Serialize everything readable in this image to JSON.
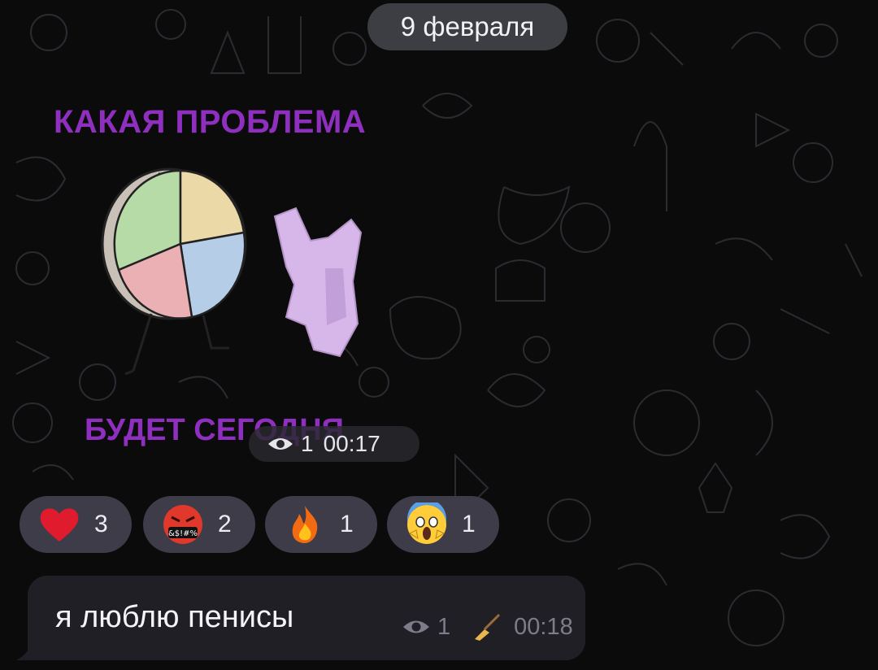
{
  "chat": {
    "date_separator": "9 февраля",
    "sticker_message": {
      "sticker_top_text": "КАКАЯ ПРОБЛЕМА",
      "sticker_bottom_text": "БУДЕТ СЕГОДНЯ",
      "views": "1",
      "time": "00:17",
      "eye_icon": "eye-icon"
    },
    "reactions": [
      {
        "emoji": "red-heart-icon",
        "count": "3"
      },
      {
        "emoji": "cursing-face-icon",
        "count": "2"
      },
      {
        "emoji": "fire-icon",
        "count": "1"
      },
      {
        "emoji": "screaming-face-icon",
        "count": "1"
      }
    ],
    "text_message": {
      "text": "я люблю пенисы",
      "views": "1",
      "time": "00:18",
      "broom_icon": "broom-icon"
    }
  },
  "colors": {
    "background": "#0b0b0c",
    "sticker_text": "#8e2fbf",
    "bubble": "#201f26",
    "reaction_pill": "#3e3c48"
  }
}
